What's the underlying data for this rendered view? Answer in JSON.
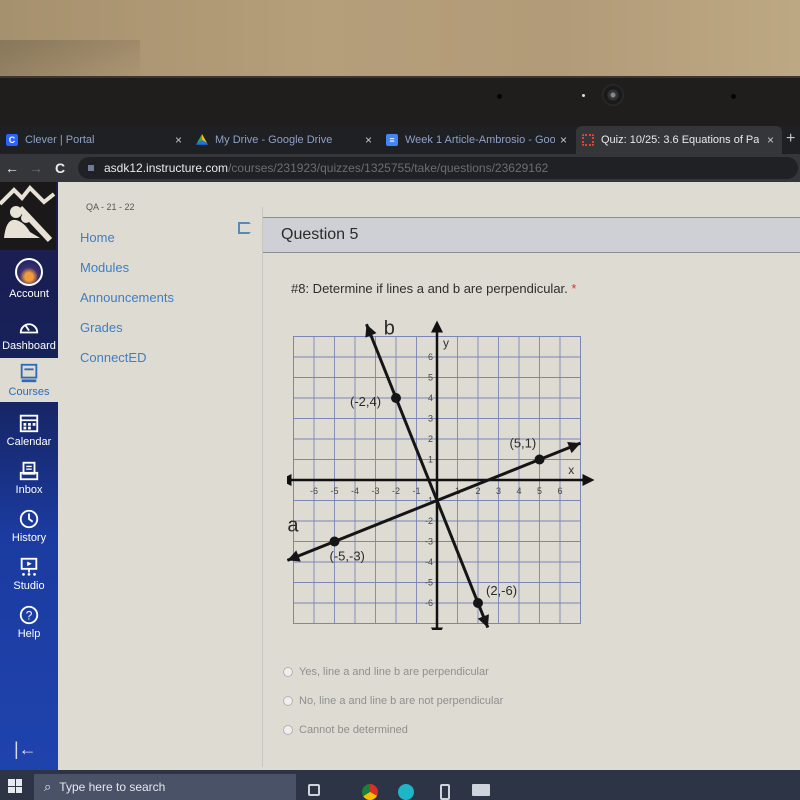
{
  "browser": {
    "tabs": [
      {
        "label": "Clever | Portal",
        "icon": "clever-icon",
        "active": false
      },
      {
        "label": "My Drive - Google Drive",
        "icon": "google-drive-icon",
        "active": false
      },
      {
        "label": "Week 1 Article-Ambrosio - Goo",
        "icon": "google-docs-icon",
        "active": false
      },
      {
        "label": "Quiz: 10/25: 3.6 Equations of Pa",
        "icon": "canvas-icon",
        "active": true
      }
    ],
    "close_glyph": "×",
    "new_tab_glyph": "+",
    "back_glyph": "←",
    "forward_glyph": "→",
    "reload_glyph": "C",
    "url_host": "asdk12.instructure.com",
    "url_path": "/courses/231923/quizzes/1325755/take/questions/23629162"
  },
  "global_nav": {
    "items": [
      {
        "label": "Account",
        "icon": "avatar"
      },
      {
        "label": "Dashboard",
        "icon": "dashboard-icon"
      },
      {
        "label": "Courses",
        "icon": "courses-icon",
        "active": true
      },
      {
        "label": "Calendar",
        "icon": "calendar-icon"
      },
      {
        "label": "Inbox",
        "icon": "inbox-icon"
      },
      {
        "label": "History",
        "icon": "history-icon"
      },
      {
        "label": "Studio",
        "icon": "studio-icon"
      },
      {
        "label": "Help",
        "icon": "help-icon"
      }
    ],
    "collapse_glyph": "|←"
  },
  "course_nav": {
    "term": "QA - 21 - 22",
    "links": [
      "Home",
      "Modules",
      "Announcements",
      "Grades",
      "ConnectED"
    ]
  },
  "question": {
    "title": "Question 5",
    "prompt": "#8: Determine if lines a and b are perpendicular.",
    "required_mark": "*",
    "options": [
      "Yes, line a and line b are perpendicular",
      "No, line a and line b are not perpendicular",
      "Cannot be determined"
    ]
  },
  "graph": {
    "x_label": "x",
    "y_label": "y",
    "x_ticks": [
      "-6",
      "-5",
      "-4",
      "-3",
      "-2",
      "-1",
      "1",
      "2",
      "3",
      "4",
      "5",
      "6"
    ],
    "y_ticks": [
      "6",
      "5",
      "4",
      "3",
      "2",
      "1",
      "-1",
      "-2",
      "-3",
      "-4",
      "-5",
      "-6"
    ],
    "tick_values": [
      -6,
      -5,
      -4,
      -3,
      -2,
      -1,
      1,
      2,
      3,
      4,
      5,
      6
    ],
    "range": [
      -7,
      7
    ],
    "lines": [
      {
        "name": "a",
        "points": [
          [
            -5,
            -3
          ],
          [
            5,
            1
          ]
        ],
        "labels": [
          "(-5,-3)",
          "(5,1)"
        ]
      },
      {
        "name": "b",
        "points": [
          [
            -2,
            4
          ],
          [
            2,
            -6
          ]
        ],
        "labels": [
          "(-2,4)",
          "(2,-6)"
        ]
      }
    ]
  },
  "taskbar": {
    "search_placeholder": "Type here to search"
  }
}
